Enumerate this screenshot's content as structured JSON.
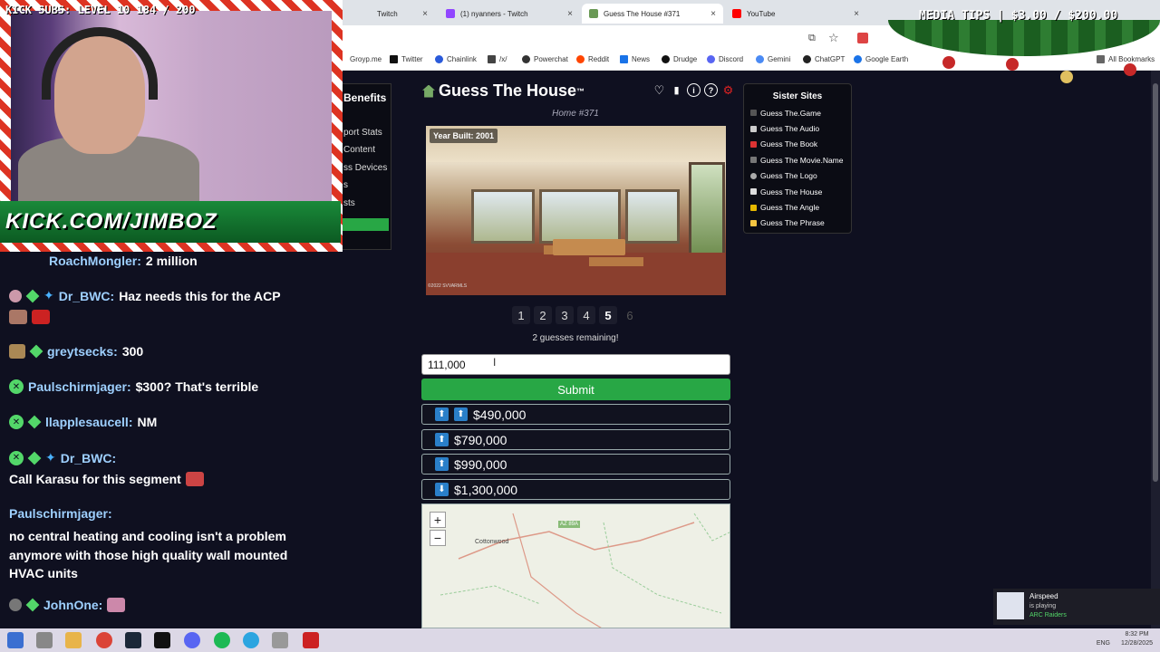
{
  "browser": {
    "tabs": [
      {
        "title": "Twitch",
        "color": "#9146ff"
      },
      {
        "title": "(1) nyanners - Twitch",
        "color": "#9146ff"
      },
      {
        "title": "Guess The House #371",
        "color": "#6a9955"
      },
      {
        "title": "YouTube",
        "color": "#ff0000"
      }
    ],
    "bookmarks": [
      "Groyp.me",
      "Twitter",
      "Chainlink",
      "/x/",
      "Powerchat",
      "Reddit",
      "News",
      "Drudge",
      "Discord",
      "Gemini",
      "ChatGPT",
      "Google Earth",
      "All Bookmarks"
    ]
  },
  "overlay": {
    "kick_subs": "KICK SUBS: LEVEL 10 184 / 200",
    "banner": "KICK.COM/JIMBOZ",
    "media_tips": "MEDIA TIPS | $3.00 / $200.00"
  },
  "benefits": {
    "title": "Benefits",
    "items": [
      "port Stats",
      "Content",
      "ss Devices",
      "s",
      "sts"
    ]
  },
  "game": {
    "title": "Guess The House",
    "trademark": "™",
    "subtitle": "Home #371",
    "year_built": "Year Built: 2001",
    "photo_credit": "©2022 SVVARMLS",
    "pages": [
      "1",
      "2",
      "3",
      "4",
      "5",
      "6"
    ],
    "current_page": "5",
    "disabled_page": "6",
    "remaining": "2 guesses remaining!",
    "input_value": "111,000",
    "submit_label": "Submit",
    "previous_guesses": [
      {
        "arrows": [
          "⬆",
          "⬆"
        ],
        "value": "$490,000"
      },
      {
        "arrows": [
          "⬆"
        ],
        "value": "$790,000"
      },
      {
        "arrows": [
          "⬆"
        ],
        "value": "$990,000"
      },
      {
        "arrows": [
          "⬇"
        ],
        "value": "$1,300,000"
      }
    ],
    "map": {
      "zoom_in": "+",
      "zoom_out": "−",
      "town": "Cottonwood",
      "highway": "AZ 89A"
    }
  },
  "sister_sites": {
    "title": "Sister Sites",
    "items": [
      {
        "label": "Guess The.Game",
        "color": "#555"
      },
      {
        "label": "Guess The Audio",
        "color": "#ccc"
      },
      {
        "label": "Guess The Book",
        "color": "#d33"
      },
      {
        "label": "Guess The Movie.Name",
        "color": "#777"
      },
      {
        "label": "Guess The Logo",
        "color": "#aaa"
      },
      {
        "label": "Guess The House",
        "color": "#ddd"
      },
      {
        "label": "Guess The Angle",
        "color": "#e6b800"
      },
      {
        "label": "Guess The Phrase",
        "color": "#f5c542"
      }
    ]
  },
  "chat": [
    {
      "user": "RoachMongler:",
      "msg": "2 million"
    },
    {
      "user": "Dr_BWC:",
      "msg": "Haz needs this for the ACP"
    },
    {
      "user": "greytsecks:",
      "msg": "300"
    },
    {
      "user": "Paulschirmjager:",
      "msg": "$300? That's terrible"
    },
    {
      "user": "llapplesaucell:",
      "msg": "NM"
    },
    {
      "user": "Dr_BWC:",
      "msg": "Call Karasu for this segment"
    },
    {
      "user": "Paulschirmjager:",
      "msg": "no central heating and cooling isn't a problem anymore with those high quality wall mounted HVAC units"
    },
    {
      "user": "JohnOne:",
      "msg": ""
    }
  ],
  "notification": {
    "title": "Airspeed",
    "line1": "is playing",
    "line2": "ARC Raiders"
  },
  "tray": {
    "lang": "ENG",
    "time": "8:32 PM",
    "date": "12/28/2025"
  }
}
